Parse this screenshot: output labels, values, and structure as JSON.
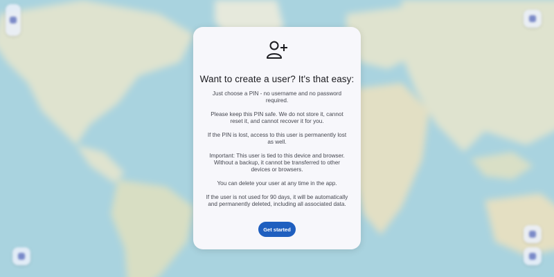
{
  "dialog": {
    "icon": "person-add-icon",
    "title": "Want to create a user? It's that easy:",
    "paragraphs": [
      "Just choose a PIN - no username and no password required.",
      "Please keep this PIN safe. We do not store it, cannot reset it, and cannot recover it for you.",
      "If the PIN is lost, access to this user is permanently lost as well.",
      "Important: This user is tied to this device and browser. Without a backup, it cannot be transferred to other devices or browsers.",
      "You can delete your user at any time in the app.",
      "If the user is not used for 90 days, it will be automatically and permanently deleted, including all associated data."
    ],
    "button_label": "Get started"
  },
  "colors": {
    "accent": "#1f5fbf",
    "ocean": "#a9d3df",
    "land": "#dfe3cf",
    "dialog_bg": "#f7f7fb"
  },
  "map_controls": {
    "top_left": "zoom-controls-icon",
    "top_right": "layers-icon",
    "bottom_left": "location-icon",
    "bottom_right_top": "search-icon",
    "bottom_right_bottom": "menu-icon"
  }
}
